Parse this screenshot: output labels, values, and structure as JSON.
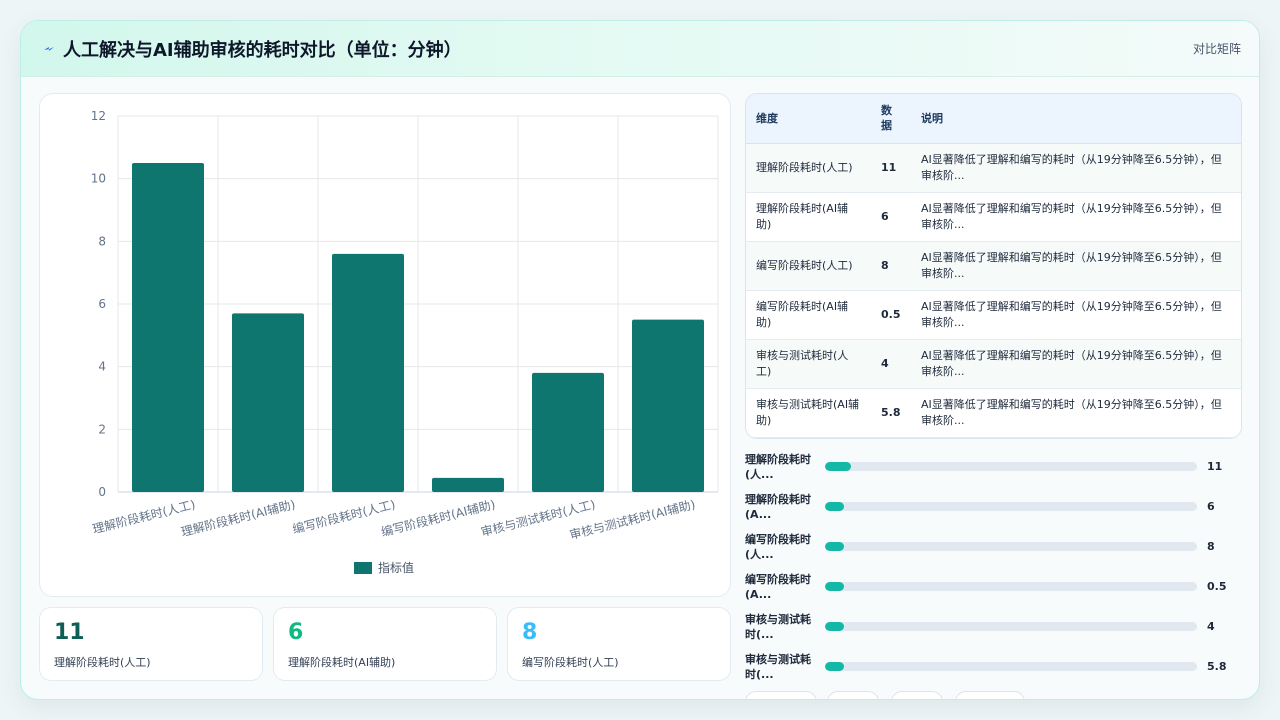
{
  "header": {
    "title": "人工解决与AI辅助审核的耗时对比（单位：分钟）",
    "right_label": "对比矩阵",
    "icon": "lightning-icon"
  },
  "colors": {
    "bar": "#0e766e",
    "progress": "#14b8a6",
    "kpi1": "#0f5e56",
    "kpi2": "#10b981",
    "kpi3": "#38bdf8"
  },
  "chart_data": {
    "type": "bar",
    "categories": [
      "理解阶段耗时(人工)",
      "理解阶段耗时(AI辅助)",
      "编写阶段耗时(人工)",
      "编写阶段耗时(AI辅助)",
      "审核与测试耗时(人工)",
      "审核与测试耗时(AI辅助)"
    ],
    "series": [
      {
        "name": "指标值",
        "values": [
          10.5,
          5.7,
          7.6,
          0.45,
          3.8,
          5.5
        ]
      }
    ],
    "ylim": [
      0,
      12
    ],
    "yticks": [
      0,
      2,
      4,
      6,
      8,
      10,
      12
    ],
    "grid": true,
    "legend": "bottom"
  },
  "kpis": [
    {
      "value": "11",
      "label": "理解阶段耗时(人工)"
    },
    {
      "value": "6",
      "label": "理解阶段耗时(AI辅助)"
    },
    {
      "value": "8",
      "label": "编写阶段耗时(人工)"
    }
  ],
  "table": {
    "headers": [
      "维度",
      "数据",
      "说明"
    ],
    "rows": [
      {
        "dim": "理解阶段耗时(人工)",
        "val": "11",
        "desc": "AI显著降低了理解和编写的耗时（从19分钟降至6.5分钟），但审核阶..."
      },
      {
        "dim": "理解阶段耗时(AI辅助)",
        "val": "6",
        "desc": "AI显著降低了理解和编写的耗时（从19分钟降至6.5分钟），但审核阶..."
      },
      {
        "dim": "编写阶段耗时(人工)",
        "val": "8",
        "desc": "AI显著降低了理解和编写的耗时（从19分钟降至6.5分钟），但审核阶..."
      },
      {
        "dim": "编写阶段耗时(AI辅助)",
        "val": "0.5",
        "desc": "AI显著降低了理解和编写的耗时（从19分钟降至6.5分钟），但审核阶..."
      },
      {
        "dim": "审核与测试耗时(人工)",
        "val": "4",
        "desc": "AI显著降低了理解和编写的耗时（从19分钟降至6.5分钟），但审核阶..."
      },
      {
        "dim": "审核与测试耗时(AI辅助)",
        "val": "5.8",
        "desc": "AI显著降低了理解和编写的耗时（从19分钟降至6.5分钟），但审核阶..."
      }
    ]
  },
  "progress": [
    {
      "label": "理解阶段耗时(人...",
      "value": "11",
      "fill": 0.07
    },
    {
      "label": "理解阶段耗时(A...",
      "value": "6",
      "fill": 0.05
    },
    {
      "label": "编写阶段耗时(人...",
      "value": "8",
      "fill": 0.05
    },
    {
      "label": "编写阶段耗时(A...",
      "value": "0.5",
      "fill": 0.05
    },
    {
      "label": "审核与测试耗时(...",
      "value": "4",
      "fill": 0.05
    },
    {
      "label": "审核与测试耗时(...",
      "value": "5.8",
      "fill": 0.05
    }
  ]
}
